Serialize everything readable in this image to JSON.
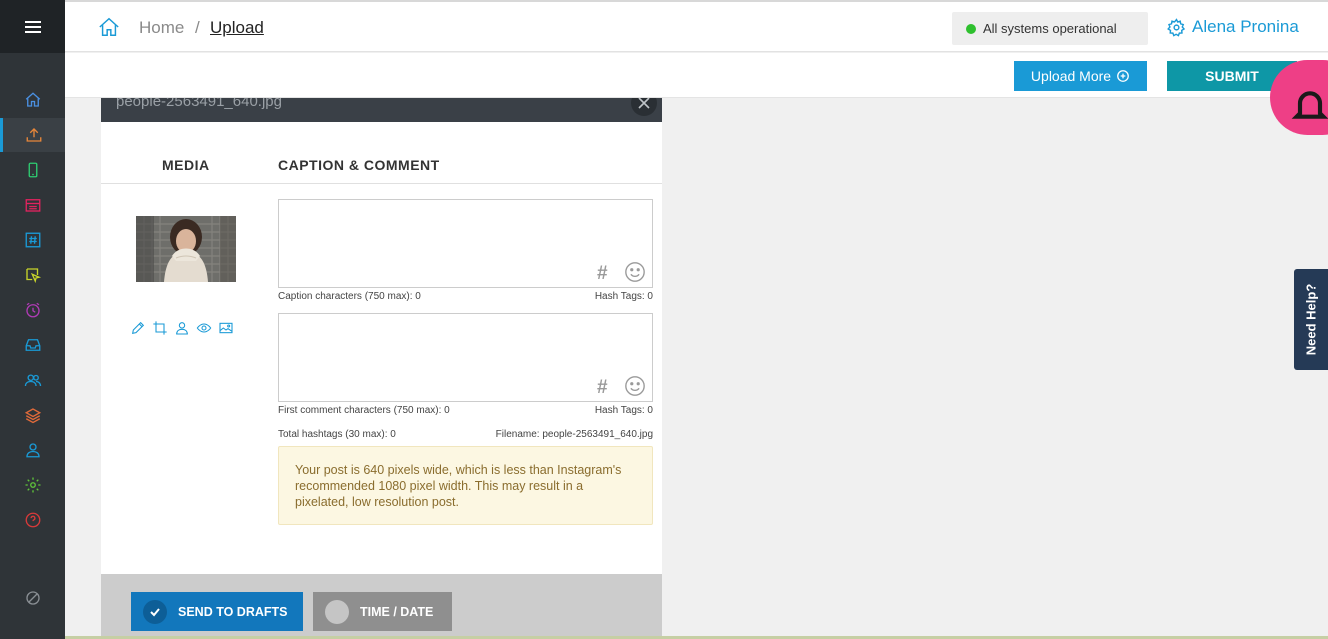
{
  "header": {
    "breadcrumb_home": "Home",
    "breadcrumb_sep": "/",
    "breadcrumb_current": "Upload",
    "status_text": "All systems operational",
    "status_color": "#2ec02e",
    "user_name": "Alena Pronina"
  },
  "toolbar": {
    "upload_more_label": "Upload More",
    "submit_label": "SUBMIT"
  },
  "sidebar": {
    "items": [
      {
        "icon": "home-icon",
        "color": "#4a90e2"
      },
      {
        "icon": "upload-icon",
        "color": "#e8873a",
        "active": true
      },
      {
        "icon": "phone-icon",
        "color": "#2ecc71"
      },
      {
        "icon": "calendar-icon",
        "color": "#e0245e"
      },
      {
        "icon": "hashtag-icon",
        "color": "#1a9ad6"
      },
      {
        "icon": "cursor-icon",
        "color": "#c8d42a"
      },
      {
        "icon": "clock-icon",
        "color": "#b03bb5"
      },
      {
        "icon": "inbox-icon",
        "color": "#1a9ad6"
      },
      {
        "icon": "users-icon",
        "color": "#1a9ad6"
      },
      {
        "icon": "layers-icon",
        "color": "#e06a3a"
      },
      {
        "icon": "user-icon",
        "color": "#1a9ad6"
      },
      {
        "icon": "gear-icon",
        "color": "#5fc43a"
      },
      {
        "icon": "help-icon",
        "color": "#d63a3a"
      },
      {
        "icon": "block-icon",
        "color": "#8a8f94"
      }
    ]
  },
  "modal": {
    "filename": "people-2563491_640.jpg",
    "col_media": "MEDIA",
    "col_caption": "CAPTION & COMMENT",
    "caption_value": "",
    "caption_chars": "Caption characters (750 max): 0",
    "caption_hashtags": "Hash Tags: 0",
    "comment_value": "",
    "comment_chars": "First comment characters (750 max): 0",
    "comment_hashtags": "Hash Tags: 0",
    "total_hashtags": "Total hashtags (30 max): 0",
    "filename_label": "Filename: people-2563491_640.jpg",
    "hash_symbol": "#",
    "warning": "Your post is 640 pixels wide, which is less than Instagram's recommended 1080 pixel width. This may result in a pixelated, low resolution post.",
    "send_drafts_label": "SEND TO DRAFTS",
    "time_date_label": "TIME / DATE"
  },
  "help_tab": {
    "label": "Need Help?"
  }
}
